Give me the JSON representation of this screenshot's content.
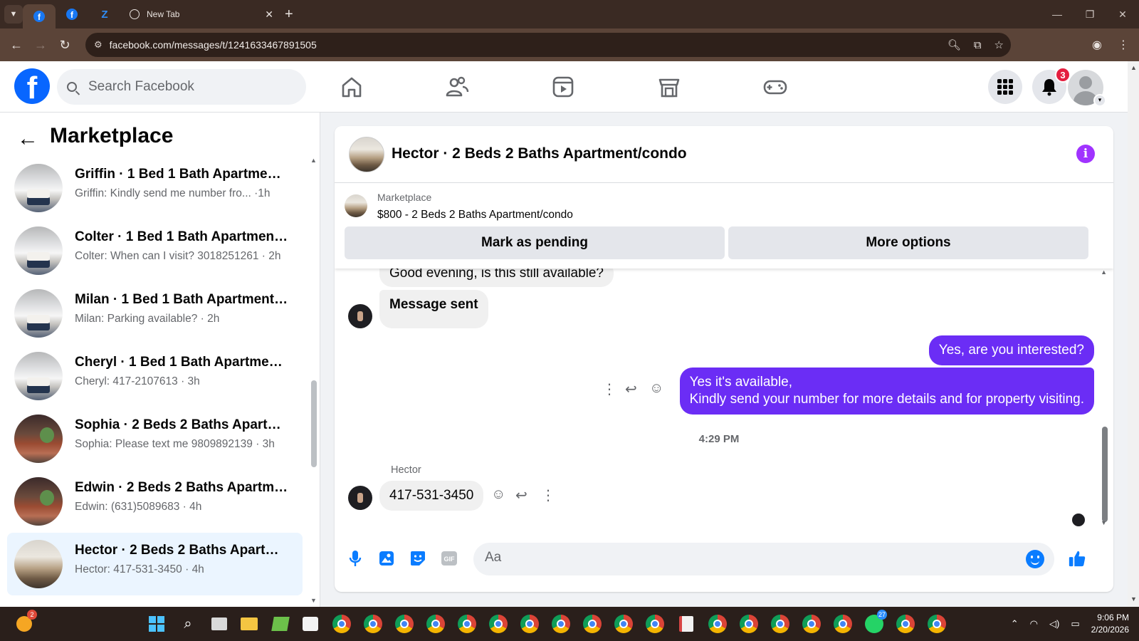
{
  "browser": {
    "tabs": [
      {
        "icon": "facebook-icon",
        "label": ""
      },
      {
        "icon": "facebook-icon",
        "label": ""
      },
      {
        "icon": "zillow-icon",
        "label": ""
      },
      {
        "icon": "globe-icon",
        "label": "New Tab"
      }
    ],
    "url": "facebook.com/messages/t/1241633467891505"
  },
  "header": {
    "search_placeholder": "Search Facebook",
    "notification_count": "3"
  },
  "sidebar": {
    "title": "Marketplace",
    "conversations": [
      {
        "title": "Griffin · 1 Bed 1 Bath Apartment/...",
        "preview": "Griffin: Kindly send me number fro...  ·1h",
        "image": "living-room"
      },
      {
        "title": "Colter · 1 Bed 1 Bath Apartment/...",
        "preview": "Colter: When can I visit? 3018251261 · 2h",
        "image": "living-room"
      },
      {
        "title": "Milan · 1 Bed 1 Bath Apartment/c...",
        "preview": "Milan: Parking available? · 2h",
        "image": "living-room"
      },
      {
        "title": "Cheryl · 1 Bed 1 Bath Apartment/...",
        "preview": "Cheryl: 417-2107613 · 3h",
        "image": "living-room"
      },
      {
        "title": "Sophia · 2 Beds 2 Baths Apartme...",
        "preview": "Sophia: Please text me 9809892139 · 3h",
        "image": "patio"
      },
      {
        "title": "Edwin · 2 Beds 2 Baths Apartme...",
        "preview": "Edwin: (631)5089683 · 4h",
        "image": "patio"
      },
      {
        "title": "Hector · 2 Beds 2 Baths Apartme...",
        "preview": "Hector: 417-531-3450 · 4h",
        "image": "open-living",
        "active": true
      }
    ]
  },
  "chat": {
    "title": "Hector · 2 Beds 2 Baths Apartment/condo",
    "marketplace_label": "Marketplace",
    "listing": "$800 - 2 Beds 2 Baths Apartment/condo",
    "mark_pending_label": "Mark as pending",
    "more_options_label": "More options",
    "messages": [
      {
        "from": "Hector",
        "text": "Good evening, is this still available?"
      },
      {
        "from": "Hector",
        "text": "Message sent"
      },
      {
        "from": "me",
        "text": "Yes, are you interested?"
      },
      {
        "from": "me",
        "line1": "Yes it's available,",
        "line2": "Kindly send your number for more details and for property visiting."
      }
    ],
    "timestamp": "4:29 PM",
    "sender_name": "Hector",
    "last_message": "417-531-3450",
    "composer_placeholder": "Aa",
    "accent_color": "#6b2df5"
  },
  "taskbar": {
    "time": "9:06 PM",
    "date": "2/20/2026",
    "start_badge": "2",
    "whatsapp_badge": "27"
  }
}
